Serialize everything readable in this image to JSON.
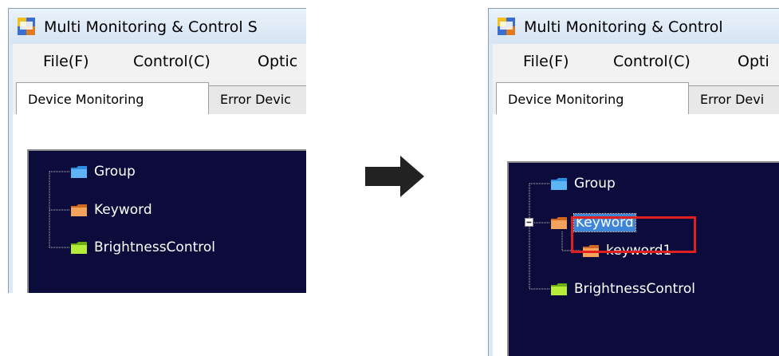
{
  "left_window": {
    "title": "Multi Monitoring & Control S",
    "menu": [
      "File(F)",
      "Control(C)",
      "Optic"
    ],
    "tabs": [
      "Device Monitoring",
      "Error Devic"
    ],
    "tree": [
      "Group",
      "Keyword",
      "BrightnessControl"
    ]
  },
  "right_window": {
    "title": "Multi Monitoring & Control",
    "menu": [
      "File(F)",
      "Control(C)",
      "Opti"
    ],
    "tabs": [
      "Device Monitoring",
      "Error Devi"
    ],
    "tree": {
      "group": "Group",
      "keyword": "Keyword",
      "keyword_child": "keyword1",
      "brightness": "BrightnessControl"
    }
  },
  "icons": {
    "app": "monitor-app-icon",
    "folder_group": "#2a8fe0",
    "folder_keyword": "#f08a3a",
    "folder_brightness": "#9ad820",
    "arrow": "arrow-right-icon"
  },
  "colors": {
    "tree_background": "#0b0b3c",
    "selection": "#3f86d8",
    "highlight_border": "#e02020"
  }
}
